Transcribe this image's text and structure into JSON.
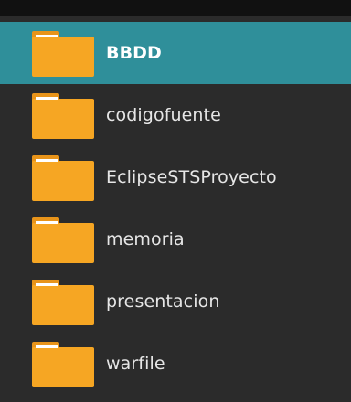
{
  "file_list": {
    "items": [
      {
        "label": "BBDD",
        "icon": "folder-icon",
        "selected": true
      },
      {
        "label": "codigofuente",
        "icon": "folder-icon",
        "selected": false
      },
      {
        "label": "EclipseSTSProyecto",
        "icon": "folder-icon",
        "selected": false
      },
      {
        "label": "memoria",
        "icon": "folder-icon",
        "selected": false
      },
      {
        "label": "presentacion",
        "icon": "folder-icon",
        "selected": false
      },
      {
        "label": "warfile",
        "icon": "folder-icon",
        "selected": false
      }
    ]
  },
  "colors": {
    "selection": "#2f8f9a",
    "folder": "#f6a623",
    "background": "#2b2b2b"
  }
}
